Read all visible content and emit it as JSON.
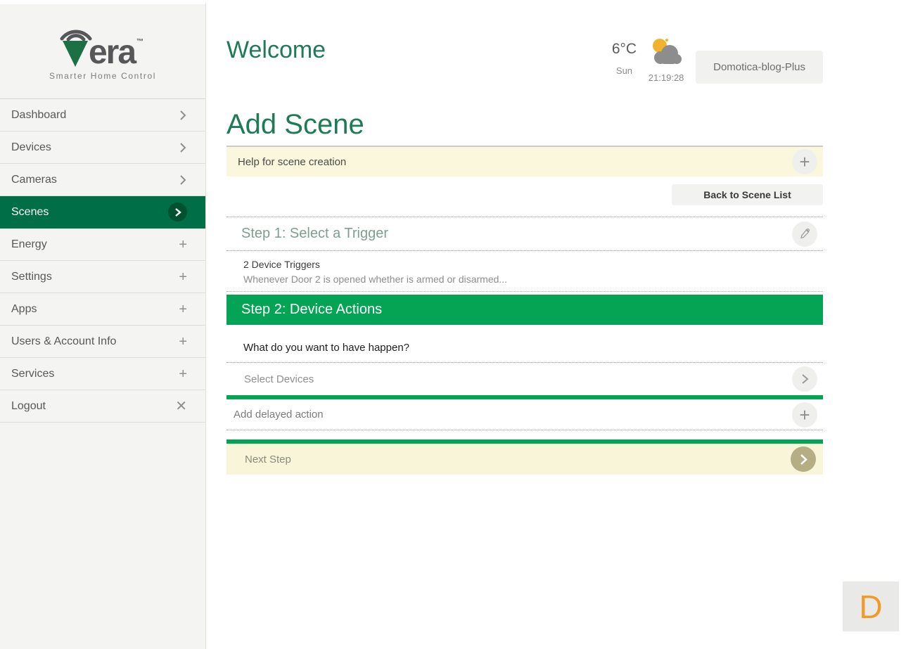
{
  "brand": {
    "name": "vera",
    "wordmark_rest": "era",
    "trademark": "™",
    "tagline": "Smarter Home Control"
  },
  "sidebar": {
    "items": [
      {
        "label": "Dashboard",
        "icon": "chevron-right",
        "active": false
      },
      {
        "label": "Devices",
        "icon": "chevron-right",
        "active": false
      },
      {
        "label": "Cameras",
        "icon": "chevron-right",
        "active": false
      },
      {
        "label": "Scenes",
        "icon": "chevron-right-circle",
        "active": true
      },
      {
        "label": "Energy",
        "icon": "plus",
        "active": false
      },
      {
        "label": "Settings",
        "icon": "plus",
        "active": false
      },
      {
        "label": "Apps",
        "icon": "plus",
        "active": false
      },
      {
        "label": "Users & Account Info",
        "icon": "plus",
        "active": false
      },
      {
        "label": "Services",
        "icon": "plus",
        "active": false
      },
      {
        "label": "Logout",
        "icon": "close",
        "active": false
      }
    ]
  },
  "header": {
    "title": "Welcome",
    "weather": {
      "temperature": "6°C",
      "day": "Sun",
      "time": "21:19:28",
      "icon": "cloudy-night-icon"
    },
    "controller_button": "Domotica-blog-Plus"
  },
  "scene": {
    "page_title": "Add Scene",
    "help_bar_label": "Help for scene creation",
    "back_button": "Back to Scene List",
    "step1": {
      "title": "Step 1: Select a Trigger",
      "summary_title": "2 Device Triggers",
      "summary_detail": "Whenever Door 2 is opened whether is armed or disarmed...",
      "edit_icon": "pencil-icon"
    },
    "step2": {
      "title": "Step 2: Device Actions",
      "question": "What do you want to have happen?",
      "select_devices_label": "Select Devices",
      "add_delayed_label": "Add delayed action"
    },
    "next_step_label": "Next Step"
  },
  "badge": {
    "letter": "D"
  },
  "colors": {
    "accent_green": "#04a455",
    "sidebar_active_green": "#006e47",
    "heading_green": "#1e7b56",
    "help_yellow": "#faf7dc",
    "next_step_yellow": "#f8f5d8",
    "olive_button": "#b5ae85",
    "badge_orange": "#f29a28"
  }
}
